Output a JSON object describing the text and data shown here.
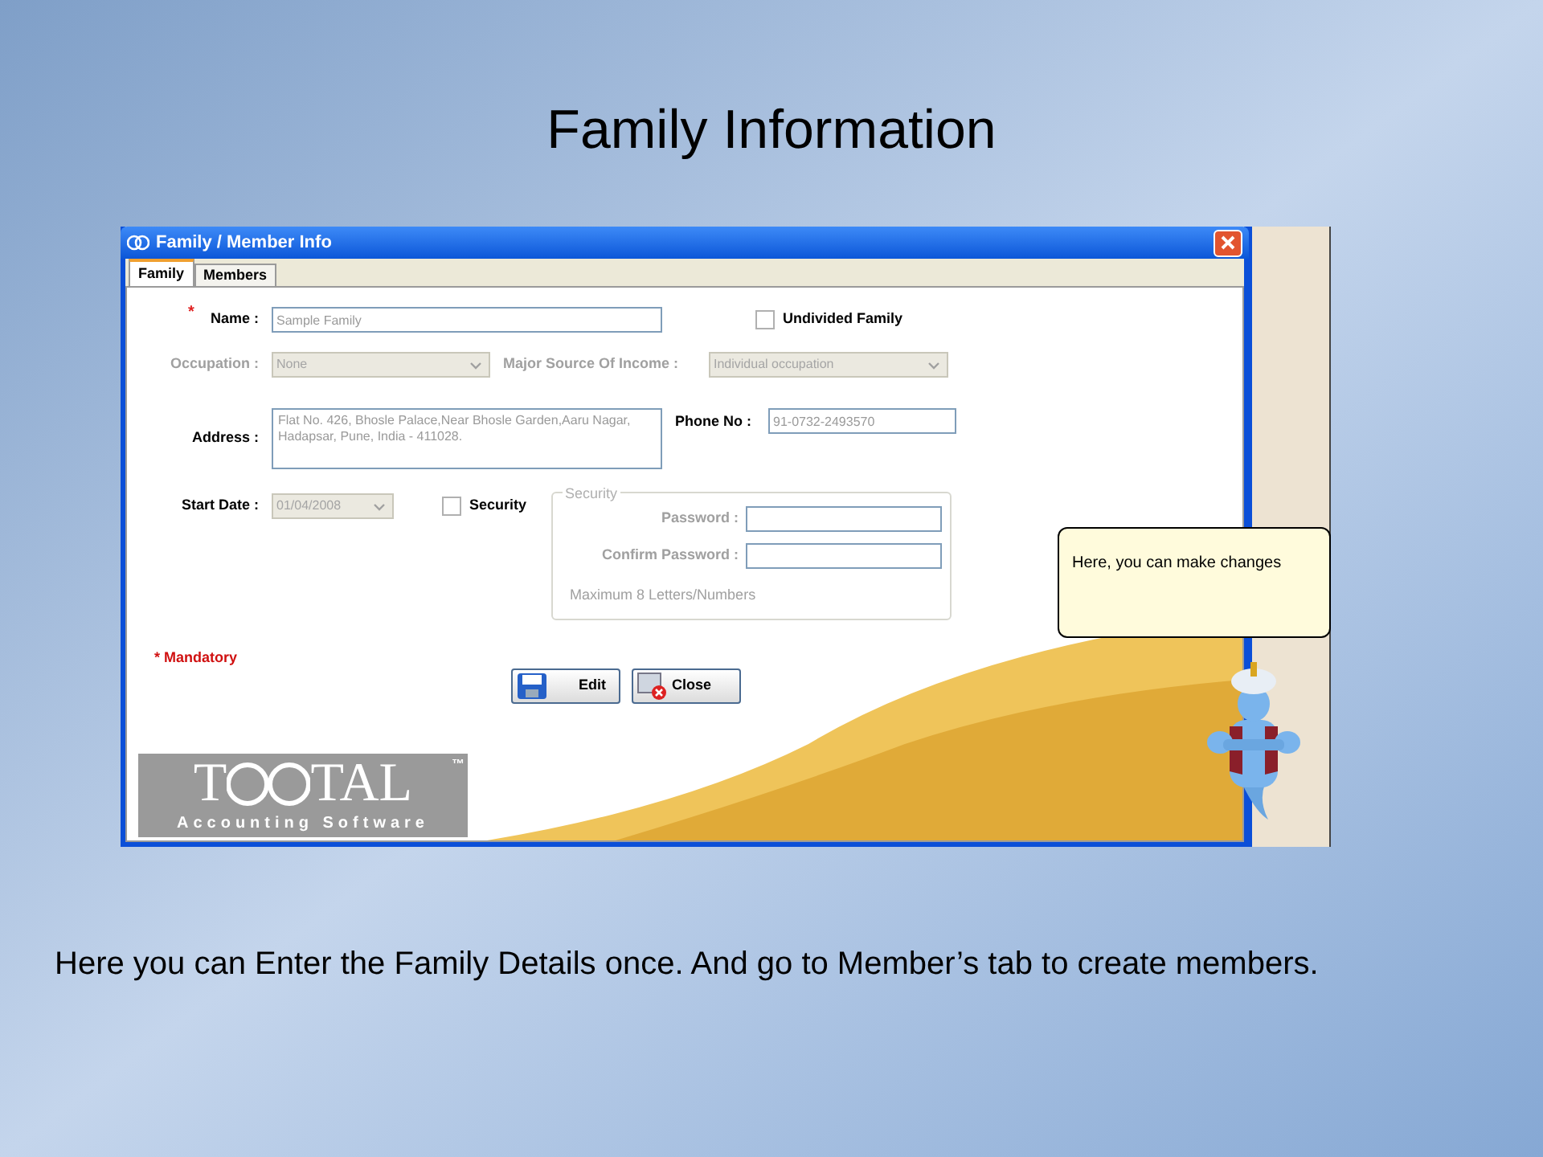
{
  "slide": {
    "title": "Family Information",
    "caption": "Here you can Enter the Family Details once. And go to Member’s tab to create members."
  },
  "window": {
    "title": "Family / Member Info",
    "tabs": [
      {
        "label": "Family",
        "selected": true
      },
      {
        "label": "Members",
        "selected": false
      }
    ],
    "name": {
      "label": "Name :",
      "required_mark": "*",
      "value": "Sample Family"
    },
    "undivided_family": {
      "label": "Undivided Family",
      "checked": false
    },
    "occupation": {
      "label": "Occupation :",
      "value": "None",
      "disabled": true
    },
    "income_source": {
      "label": "Major Source Of Income :",
      "value": "Individual occupation",
      "disabled": true
    },
    "address": {
      "label": "Address :",
      "value": "Flat No. 426, Bhosle Palace,Near Bhosle Garden,Aaru Nagar, Hadapsar, Pune, India - 411028."
    },
    "phone": {
      "label": "Phone No :",
      "value": "91-0732-2493570"
    },
    "start_date": {
      "label": "Start Date :",
      "value": "01/04/2008",
      "disabled": true
    },
    "security_checkbox": {
      "label": "Security",
      "checked": false
    },
    "security_group": {
      "legend": "Security",
      "disabled": true,
      "password_label": "Password :",
      "confirm_label": "Confirm Password :",
      "hint": "Maximum 8 Letters/Numbers"
    },
    "mandatory_note": "* Mandatory",
    "buttons": [
      {
        "label": "Edit",
        "kind": "save"
      },
      {
        "label": "Close",
        "kind": "close"
      }
    ],
    "logo": {
      "lead": "T",
      "tail": "TAL",
      "trademark": "™",
      "tagline": "Accounting Software"
    }
  },
  "assistant": {
    "message": "Here, you can make changes"
  }
}
